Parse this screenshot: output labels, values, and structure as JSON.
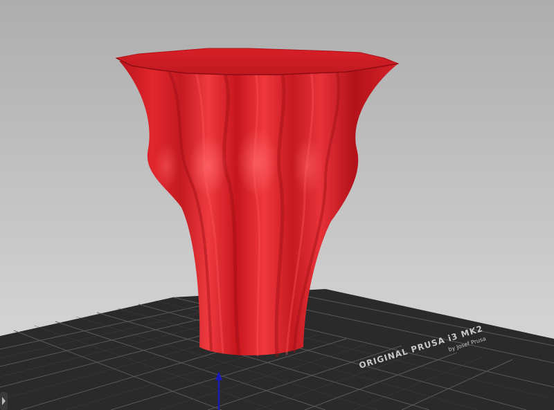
{
  "app": {
    "view": "3D plater viewport"
  },
  "colors": {
    "background_top": "#b4b4b4",
    "background_bottom": "#d9d9d9",
    "model": "#e0282e",
    "model_shadow": "#a8121a",
    "bed": "#2b2b2b",
    "bed_grid": "#6a6a6a",
    "axis_z": "#1f1fc8"
  },
  "bed": {
    "label_main": "ORIGINAL PRUSA i3  MK2",
    "label_sub": "by Josef Prusa"
  },
  "model": {
    "icon": "vase-model-icon"
  }
}
